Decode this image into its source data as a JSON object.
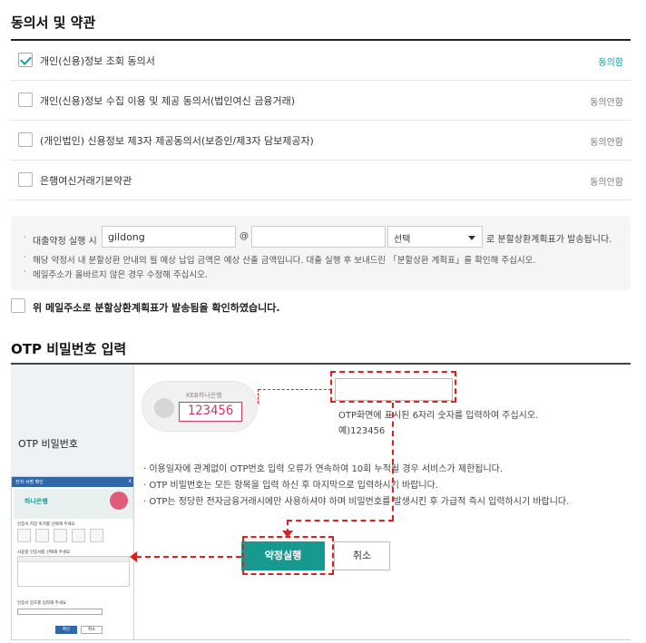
{
  "agreements": {
    "title": "동의서 및 약관",
    "items": [
      {
        "label": "개인(신용)정보 조회 동의서",
        "status": "동의함",
        "checked": true
      },
      {
        "label": "개인(신용)정보 수집 이용 및 제공 동의서(법인여신 금융거래)",
        "status": "동의안함",
        "checked": false
      },
      {
        "label": "(개인법인) 신용정보 제3자 제공동의서(보증인/제3자 담보제공자)",
        "status": "동의안함",
        "checked": false
      },
      {
        "label": "은행여신거래기본약관",
        "status": "동의안함",
        "checked": false
      }
    ]
  },
  "email": {
    "prefix": "대출약정 실행 시",
    "local_value": "gildong",
    "at": "@",
    "domain_value": "",
    "select_value": "선택",
    "suffix": "로 분할상환계획표가 발송됩니다.",
    "notes": [
      "해당 약정서 내 분할상환 안내의 월 예상 납입 금액은 예상 산출 금액입니다.  대출 실행 후 보내드린 「분할상환 계획표」를 확인해 주십시오.",
      "메일주소가 올바르지 않은 경우 수정해 주십시오."
    ],
    "confirm_label": "위 메일주소로 분할상환계획표가 발송됨을 확인하였습니다."
  },
  "otp": {
    "title": "OTP 비밀번호 입력",
    "row_label": "OTP 비밀번호",
    "token_brand": "KEB하나은행",
    "token_code": "123456",
    "input_value": "",
    "hint": "OTP화면에 표시된 6자리 숫자를 입력하여 주십시오.",
    "example": "예)123456",
    "notes": [
      "이용일자에 관계없이 OTP번호 입력 오류가 연속하여 10회 누적될 경우 서비스가 제한됩니다.",
      "OTP 비밀번호는 모든 항목을 입력 하신 후 마지막으로 입력하시기 바랍니다.",
      "OTP는 정당한 전자금융거래시에만 사용하셔야 하며 비밀번호를 발생시킨 후 가급적 즉시 입력하시기 바랍니다."
    ]
  },
  "actions": {
    "execute_label": "약정실행",
    "cancel_label": "취소"
  },
  "popup": {
    "title": "전자 서명 확인",
    "close": "x",
    "logo": "하나은행",
    "line1": "인증서 저장 위치를 선택해 주세요",
    "line2": "사용할 인증서를 선택해 주세요",
    "line3": "인증서 암호를 입력해 주세요",
    "ok": "확인",
    "cancel": "취소"
  },
  "colors": {
    "accent": "#17998f",
    "token_code": "#d3366a",
    "annotation": "#e02020"
  }
}
